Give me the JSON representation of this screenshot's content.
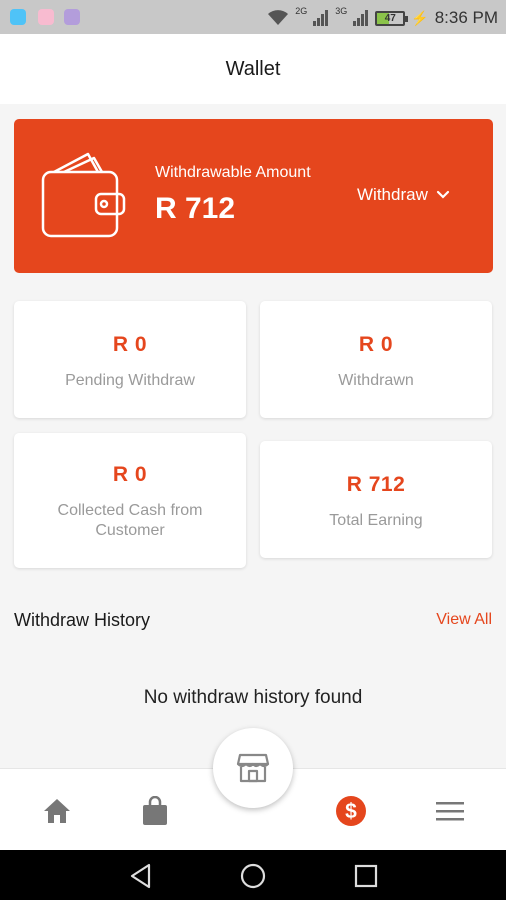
{
  "status_bar": {
    "time": "8:36 PM",
    "battery": "47",
    "network_1": "2G",
    "network_2": "3G"
  },
  "header": {
    "title": "Wallet"
  },
  "wallet": {
    "label": "Withdrawable Amount",
    "amount": "R 712",
    "withdraw_label": "Withdraw",
    "accent_color": "#e5461d"
  },
  "stats": [
    {
      "value": "R 0",
      "label": "Pending Withdraw"
    },
    {
      "value": "R 0",
      "label": "Withdrawn"
    },
    {
      "value": "R 0",
      "label": "Collected Cash from Customer"
    },
    {
      "value": "R 712",
      "label": "Total Earning"
    }
  ],
  "history": {
    "title": "Withdraw History",
    "view_all": "View All",
    "empty_message": "No withdraw history found"
  },
  "bottom_nav": {
    "items": [
      {
        "icon": "home-icon"
      },
      {
        "icon": "shopping-bag-icon"
      },
      {
        "icon": "store-icon"
      },
      {
        "icon": "dollar-icon",
        "active": true
      },
      {
        "icon": "menu-icon"
      }
    ]
  },
  "system_nav": {
    "items": [
      "back-icon",
      "home-circle-icon",
      "recents-icon"
    ]
  }
}
